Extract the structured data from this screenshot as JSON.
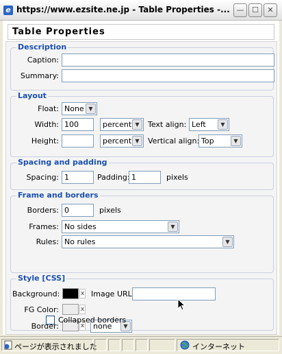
{
  "window": {
    "title": "https://www.ezsite.ne.jp - Table Properties -...",
    "minimize_symbol": "—",
    "maximize_symbol": "☐",
    "close_symbol": "✕"
  },
  "dialog": {
    "heading": "Table Properties",
    "description": {
      "legend": "Description",
      "caption_label": "Caption:",
      "caption_value": "",
      "summary_label": "Summary:",
      "summary_value": ""
    },
    "layout": {
      "legend": "Layout",
      "float_label": "Float:",
      "float_value": "None",
      "width_label": "Width:",
      "width_value": "100",
      "width_unit": "percent",
      "text_align_label": "Text align:",
      "text_align_value": "Left",
      "height_label": "Height:",
      "height_value": "",
      "height_unit": "percent",
      "vertical_align_label": "Vertical align:",
      "vertical_align_value": "Top"
    },
    "spacing": {
      "legend": "Spacing and padding",
      "spacing_label": "Spacing:",
      "spacing_value": "1",
      "padding_label": "Padding:",
      "padding_value": "1",
      "unit": "pixels"
    },
    "frame": {
      "legend": "Frame and borders",
      "borders_label": "Borders:",
      "borders_value": "0",
      "borders_unit": "pixels",
      "frames_label": "Frames:",
      "frames_value": "No sides",
      "rules_label": "Rules:",
      "rules_value": "No rules"
    },
    "style": {
      "legend": "Style [CSS]",
      "background_label": "Background:",
      "background_color": "#000000",
      "image_url_label": "Image URL:",
      "image_url_value": "",
      "fg_color_label": "FG Color:",
      "fg_color": "#ececec",
      "border_label": "Border:",
      "border_color": "#ececec",
      "border_style_value": "none",
      "collapsed_label": "Collapsed borders",
      "collapsed_checked": false,
      "clear_symbol": "x"
    }
  },
  "statusbar": {
    "status_text": "ページが表示されました",
    "zone_text": "インターネット"
  },
  "colors": {
    "legend": "#1a4fb0",
    "title_bar": "#f3f3f3",
    "status_bar": "#ece9d8"
  },
  "icons": [
    "ie-page-icon",
    "minimize-icon",
    "maximize-icon",
    "close-icon",
    "status-page-icon",
    "globe-icon",
    "chevron-down-icon",
    "mouse-cursor-icon"
  ]
}
